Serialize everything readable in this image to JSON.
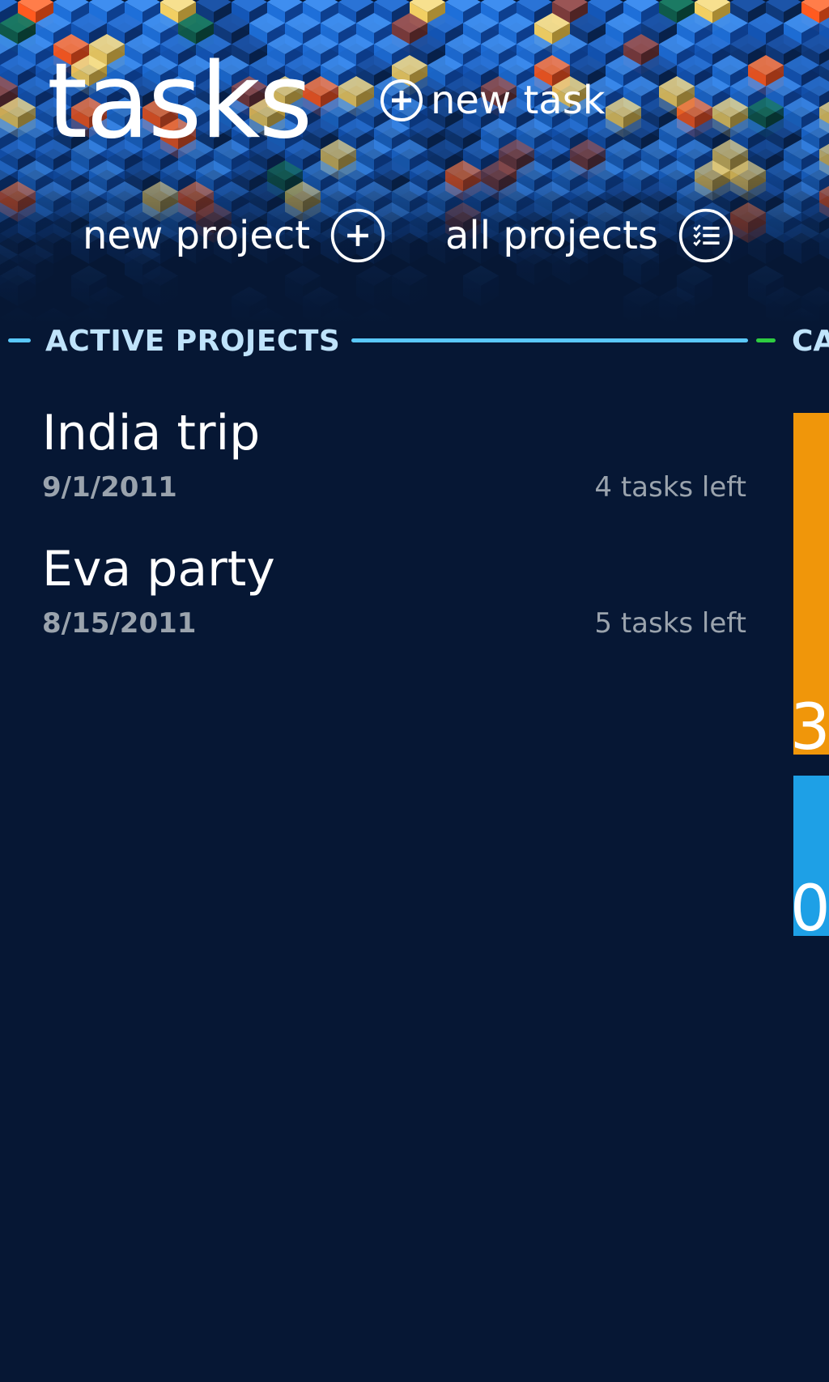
{
  "app": {
    "title": "tasks"
  },
  "commands": {
    "new_task": "new task",
    "new_project": "new project",
    "all_projects": "all projects"
  },
  "sections": {
    "active_projects": "ACTIVE PROJECTS",
    "next_section_partial": "CA"
  },
  "projects": [
    {
      "name": "India trip",
      "date": "9/1/2011",
      "tasks_left": "4 tasks left"
    },
    {
      "name": "Eva party",
      "date": "8/15/2011",
      "tasks_left": "5 tasks left"
    }
  ],
  "tiles": [
    {
      "count": "3",
      "color": "#f0960a"
    },
    {
      "count": "0",
      "color": "#1ea0e6"
    }
  ],
  "colors": {
    "background": "#061734",
    "section_header": "#bfe3fb",
    "accent_rule": "#5ac8fa",
    "accent_green": "#2ecc40",
    "secondary_text": "#9aa3ad",
    "cube_blue": "#1e6fd9",
    "cube_yellow": "#f2cf63",
    "cube_orange": "#ff5a1f"
  },
  "icons": {
    "new_task": "add-circle-icon",
    "new_project": "add-circle-icon",
    "all_projects": "list-circle-icon"
  }
}
